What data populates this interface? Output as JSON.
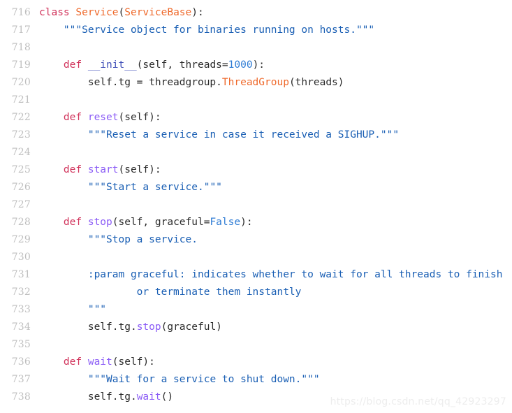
{
  "editor": {
    "language": "python",
    "first_line_number": 716,
    "background_color": "#ffffff",
    "gutter_color": "#bfbfbf",
    "default_text_color": "#2b2b2b"
  },
  "syntax_colors": {
    "keyword": "#d1335b",
    "class_name": "#ef6a2c",
    "function_name": "#8b5cf6",
    "dunder": "#3f4fb8",
    "string": "#1a5fb4",
    "number": "#2d7bd4",
    "constant": "#2d7bd4",
    "plain": "#2b2b2b"
  },
  "lines": [
    {
      "number": "716",
      "tokens": [
        {
          "text": "class ",
          "type": "keyword"
        },
        {
          "text": "Service",
          "type": "class_name"
        },
        {
          "text": "(",
          "type": "plain"
        },
        {
          "text": "ServiceBase",
          "type": "class_name"
        },
        {
          "text": "):",
          "type": "plain"
        }
      ]
    },
    {
      "number": "717",
      "tokens": [
        {
          "text": "    ",
          "type": "plain"
        },
        {
          "text": "\"\"\"Service object for binaries running on hosts.\"\"\"",
          "type": "string"
        }
      ]
    },
    {
      "number": "718",
      "tokens": []
    },
    {
      "number": "719",
      "tokens": [
        {
          "text": "    ",
          "type": "plain"
        },
        {
          "text": "def ",
          "type": "keyword"
        },
        {
          "text": "__init__",
          "type": "dunder"
        },
        {
          "text": "(self, threads=",
          "type": "plain"
        },
        {
          "text": "1000",
          "type": "number"
        },
        {
          "text": "):",
          "type": "plain"
        }
      ]
    },
    {
      "number": "720",
      "tokens": [
        {
          "text": "        self.tg = threadgroup.",
          "type": "plain"
        },
        {
          "text": "ThreadGroup",
          "type": "class_name"
        },
        {
          "text": "(threads)",
          "type": "plain"
        }
      ]
    },
    {
      "number": "721",
      "tokens": []
    },
    {
      "number": "722",
      "tokens": [
        {
          "text": "    ",
          "type": "plain"
        },
        {
          "text": "def ",
          "type": "keyword"
        },
        {
          "text": "reset",
          "type": "function_name"
        },
        {
          "text": "(self):",
          "type": "plain"
        }
      ]
    },
    {
      "number": "723",
      "tokens": [
        {
          "text": "        ",
          "type": "plain"
        },
        {
          "text": "\"\"\"Reset a service in case it received a SIGHUP.\"\"\"",
          "type": "string"
        }
      ]
    },
    {
      "number": "724",
      "tokens": []
    },
    {
      "number": "725",
      "tokens": [
        {
          "text": "    ",
          "type": "plain"
        },
        {
          "text": "def ",
          "type": "keyword"
        },
        {
          "text": "start",
          "type": "function_name"
        },
        {
          "text": "(self):",
          "type": "plain"
        }
      ]
    },
    {
      "number": "726",
      "tokens": [
        {
          "text": "        ",
          "type": "plain"
        },
        {
          "text": "\"\"\"Start a service.\"\"\"",
          "type": "string"
        }
      ]
    },
    {
      "number": "727",
      "tokens": []
    },
    {
      "number": "728",
      "tokens": [
        {
          "text": "    ",
          "type": "plain"
        },
        {
          "text": "def ",
          "type": "keyword"
        },
        {
          "text": "stop",
          "type": "function_name"
        },
        {
          "text": "(self, graceful=",
          "type": "plain"
        },
        {
          "text": "False",
          "type": "constant"
        },
        {
          "text": "):",
          "type": "plain"
        }
      ]
    },
    {
      "number": "729",
      "tokens": [
        {
          "text": "        ",
          "type": "plain"
        },
        {
          "text": "\"\"\"Stop a service.",
          "type": "string"
        }
      ]
    },
    {
      "number": "730",
      "tokens": []
    },
    {
      "number": "731",
      "tokens": [
        {
          "text": "        ",
          "type": "plain"
        },
        {
          "text": ":param graceful: indicates whether to wait for all threads to finish",
          "type": "string"
        }
      ]
    },
    {
      "number": "732",
      "tokens": [
        {
          "text": "        ",
          "type": "plain"
        },
        {
          "text": "        or terminate them instantly",
          "type": "string"
        }
      ]
    },
    {
      "number": "733",
      "tokens": [
        {
          "text": "        ",
          "type": "plain"
        },
        {
          "text": "\"\"\"",
          "type": "string"
        }
      ]
    },
    {
      "number": "734",
      "tokens": [
        {
          "text": "        self.tg.",
          "type": "plain"
        },
        {
          "text": "stop",
          "type": "function_name"
        },
        {
          "text": "(graceful)",
          "type": "plain"
        }
      ]
    },
    {
      "number": "735",
      "tokens": []
    },
    {
      "number": "736",
      "tokens": [
        {
          "text": "    ",
          "type": "plain"
        },
        {
          "text": "def ",
          "type": "keyword"
        },
        {
          "text": "wait",
          "type": "function_name"
        },
        {
          "text": "(self):",
          "type": "plain"
        }
      ]
    },
    {
      "number": "737",
      "tokens": [
        {
          "text": "        ",
          "type": "plain"
        },
        {
          "text": "\"\"\"Wait for a service to shut down.\"\"\"",
          "type": "string"
        }
      ]
    },
    {
      "number": "738",
      "tokens": [
        {
          "text": "        self.tg.",
          "type": "plain"
        },
        {
          "text": "wait",
          "type": "function_name"
        },
        {
          "text": "()",
          "type": "plain"
        }
      ]
    }
  ],
  "watermark": {
    "text": "https://blog.csdn.net/qq_42923297",
    "color": "#ededed"
  }
}
